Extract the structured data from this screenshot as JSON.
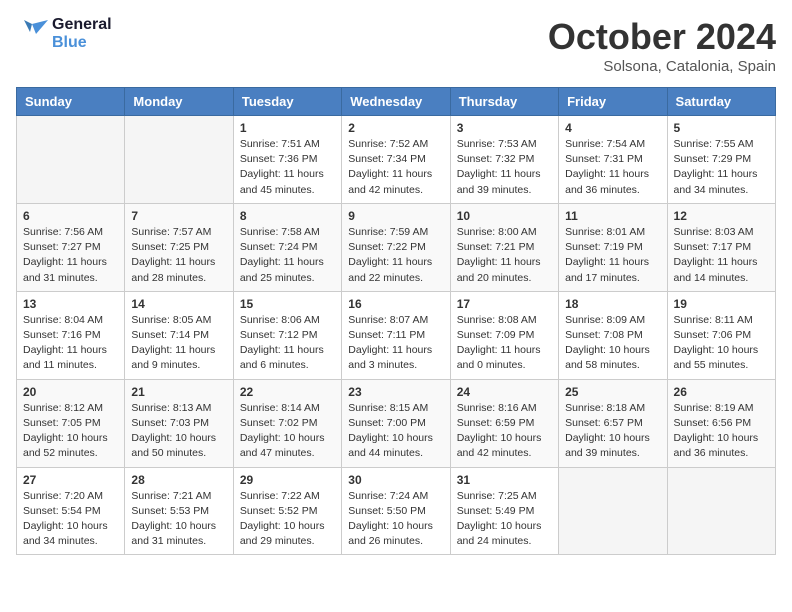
{
  "header": {
    "logo_line1": "General",
    "logo_line2": "Blue",
    "month": "October 2024",
    "location": "Solsona, Catalonia, Spain"
  },
  "weekdays": [
    "Sunday",
    "Monday",
    "Tuesday",
    "Wednesday",
    "Thursday",
    "Friday",
    "Saturday"
  ],
  "weeks": [
    [
      {
        "day": "",
        "info": ""
      },
      {
        "day": "",
        "info": ""
      },
      {
        "day": "1",
        "info": "Sunrise: 7:51 AM\nSunset: 7:36 PM\nDaylight: 11 hours and 45 minutes."
      },
      {
        "day": "2",
        "info": "Sunrise: 7:52 AM\nSunset: 7:34 PM\nDaylight: 11 hours and 42 minutes."
      },
      {
        "day": "3",
        "info": "Sunrise: 7:53 AM\nSunset: 7:32 PM\nDaylight: 11 hours and 39 minutes."
      },
      {
        "day": "4",
        "info": "Sunrise: 7:54 AM\nSunset: 7:31 PM\nDaylight: 11 hours and 36 minutes."
      },
      {
        "day": "5",
        "info": "Sunrise: 7:55 AM\nSunset: 7:29 PM\nDaylight: 11 hours and 34 minutes."
      }
    ],
    [
      {
        "day": "6",
        "info": "Sunrise: 7:56 AM\nSunset: 7:27 PM\nDaylight: 11 hours and 31 minutes."
      },
      {
        "day": "7",
        "info": "Sunrise: 7:57 AM\nSunset: 7:25 PM\nDaylight: 11 hours and 28 minutes."
      },
      {
        "day": "8",
        "info": "Sunrise: 7:58 AM\nSunset: 7:24 PM\nDaylight: 11 hours and 25 minutes."
      },
      {
        "day": "9",
        "info": "Sunrise: 7:59 AM\nSunset: 7:22 PM\nDaylight: 11 hours and 22 minutes."
      },
      {
        "day": "10",
        "info": "Sunrise: 8:00 AM\nSunset: 7:21 PM\nDaylight: 11 hours and 20 minutes."
      },
      {
        "day": "11",
        "info": "Sunrise: 8:01 AM\nSunset: 7:19 PM\nDaylight: 11 hours and 17 minutes."
      },
      {
        "day": "12",
        "info": "Sunrise: 8:03 AM\nSunset: 7:17 PM\nDaylight: 11 hours and 14 minutes."
      }
    ],
    [
      {
        "day": "13",
        "info": "Sunrise: 8:04 AM\nSunset: 7:16 PM\nDaylight: 11 hours and 11 minutes."
      },
      {
        "day": "14",
        "info": "Sunrise: 8:05 AM\nSunset: 7:14 PM\nDaylight: 11 hours and 9 minutes."
      },
      {
        "day": "15",
        "info": "Sunrise: 8:06 AM\nSunset: 7:12 PM\nDaylight: 11 hours and 6 minutes."
      },
      {
        "day": "16",
        "info": "Sunrise: 8:07 AM\nSunset: 7:11 PM\nDaylight: 11 hours and 3 minutes."
      },
      {
        "day": "17",
        "info": "Sunrise: 8:08 AM\nSunset: 7:09 PM\nDaylight: 11 hours and 0 minutes."
      },
      {
        "day": "18",
        "info": "Sunrise: 8:09 AM\nSunset: 7:08 PM\nDaylight: 10 hours and 58 minutes."
      },
      {
        "day": "19",
        "info": "Sunrise: 8:11 AM\nSunset: 7:06 PM\nDaylight: 10 hours and 55 minutes."
      }
    ],
    [
      {
        "day": "20",
        "info": "Sunrise: 8:12 AM\nSunset: 7:05 PM\nDaylight: 10 hours and 52 minutes."
      },
      {
        "day": "21",
        "info": "Sunrise: 8:13 AM\nSunset: 7:03 PM\nDaylight: 10 hours and 50 minutes."
      },
      {
        "day": "22",
        "info": "Sunrise: 8:14 AM\nSunset: 7:02 PM\nDaylight: 10 hours and 47 minutes."
      },
      {
        "day": "23",
        "info": "Sunrise: 8:15 AM\nSunset: 7:00 PM\nDaylight: 10 hours and 44 minutes."
      },
      {
        "day": "24",
        "info": "Sunrise: 8:16 AM\nSunset: 6:59 PM\nDaylight: 10 hours and 42 minutes."
      },
      {
        "day": "25",
        "info": "Sunrise: 8:18 AM\nSunset: 6:57 PM\nDaylight: 10 hours and 39 minutes."
      },
      {
        "day": "26",
        "info": "Sunrise: 8:19 AM\nSunset: 6:56 PM\nDaylight: 10 hours and 36 minutes."
      }
    ],
    [
      {
        "day": "27",
        "info": "Sunrise: 7:20 AM\nSunset: 5:54 PM\nDaylight: 10 hours and 34 minutes."
      },
      {
        "day": "28",
        "info": "Sunrise: 7:21 AM\nSunset: 5:53 PM\nDaylight: 10 hours and 31 minutes."
      },
      {
        "day": "29",
        "info": "Sunrise: 7:22 AM\nSunset: 5:52 PM\nDaylight: 10 hours and 29 minutes."
      },
      {
        "day": "30",
        "info": "Sunrise: 7:24 AM\nSunset: 5:50 PM\nDaylight: 10 hours and 26 minutes."
      },
      {
        "day": "31",
        "info": "Sunrise: 7:25 AM\nSunset: 5:49 PM\nDaylight: 10 hours and 24 minutes."
      },
      {
        "day": "",
        "info": ""
      },
      {
        "day": "",
        "info": ""
      }
    ]
  ]
}
